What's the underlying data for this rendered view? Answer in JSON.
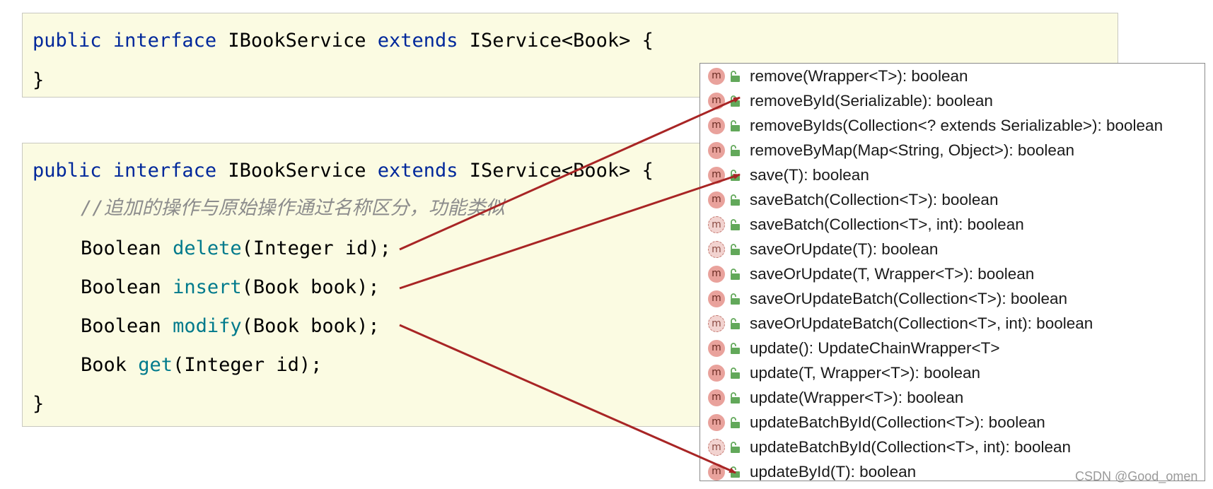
{
  "code_block_1": {
    "line1": {
      "kw1": "public",
      "kw2": "interface",
      "name": "IBookService",
      "kw3": "extends",
      "rest": "IService<Book> {"
    },
    "line2": "}"
  },
  "code_block_2": {
    "line1": {
      "kw1": "public",
      "kw2": "interface",
      "name": "IBookService",
      "kw3": "extends",
      "rest": "IService<Book> {"
    },
    "comment": "//追加的操作与原始操作通过名称区分，功能类似",
    "methods": [
      {
        "ret": "Boolean",
        "name": "delete",
        "params": "(Integer id);"
      },
      {
        "ret": "Boolean",
        "name": "insert",
        "params": "(Book book);"
      },
      {
        "ret": "Boolean",
        "name": "modify",
        "params": "(Book book);"
      },
      {
        "ret": "Book",
        "name": "get",
        "params": "(Integer id);"
      }
    ],
    "close": "}"
  },
  "popup": {
    "icon_letter": "m",
    "items": [
      {
        "text": "remove(Wrapper<T>): boolean",
        "style": "normal"
      },
      {
        "text": "removeById(Serializable): boolean",
        "style": "normal"
      },
      {
        "text": "removeByIds(Collection<? extends Serializable>): boolean",
        "style": "normal"
      },
      {
        "text": "removeByMap(Map<String, Object>): boolean",
        "style": "normal"
      },
      {
        "text": "save(T): boolean",
        "style": "normal"
      },
      {
        "text": "saveBatch(Collection<T>): boolean",
        "style": "normal"
      },
      {
        "text": "saveBatch(Collection<T>, int): boolean",
        "style": "dim"
      },
      {
        "text": "saveOrUpdate(T): boolean",
        "style": "dim"
      },
      {
        "text": "saveOrUpdate(T, Wrapper<T>): boolean",
        "style": "normal"
      },
      {
        "text": "saveOrUpdateBatch(Collection<T>): boolean",
        "style": "normal"
      },
      {
        "text": "saveOrUpdateBatch(Collection<T>, int): boolean",
        "style": "dim"
      },
      {
        "text": "update(): UpdateChainWrapper<T>",
        "style": "normal"
      },
      {
        "text": "update(T, Wrapper<T>): boolean",
        "style": "normal"
      },
      {
        "text": "update(Wrapper<T>): boolean",
        "style": "normal"
      },
      {
        "text": "updateBatchById(Collection<T>): boolean",
        "style": "normal"
      },
      {
        "text": "updateBatchById(Collection<T>, int): boolean",
        "style": "dim"
      },
      {
        "text": "updateById(T): boolean",
        "style": "normal"
      }
    ]
  },
  "colors": {
    "arrow": "#a82525",
    "keyword": "#00289b",
    "method": "#007a8c",
    "comment": "#8c8c8c",
    "code_bg": "#fbfbe2",
    "lock": "#62a85a"
  },
  "watermark": "CSDN @Good_omen"
}
